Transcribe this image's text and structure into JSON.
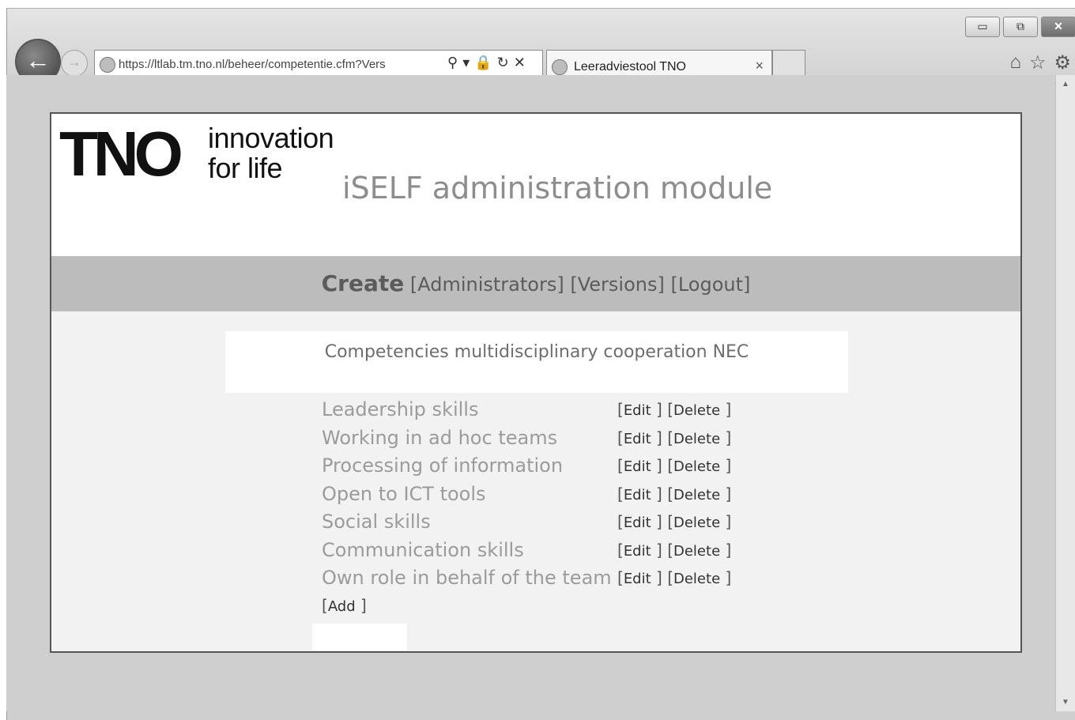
{
  "browser": {
    "url": "https://ltlab.tm.tno.nl/beheer/competentie.cfm?Vers",
    "tab_title": "Leeradviestool TNO",
    "window_controls": [
      "minimize-icon",
      "restore-icon",
      "close-icon"
    ],
    "toolbar_icons": [
      "home-icon",
      "favorites-icon",
      "settings-icon"
    ],
    "address_icons": [
      "search-icon",
      "dropdown-icon",
      "lock-icon",
      "refresh-icon",
      "stop-icon"
    ]
  },
  "header": {
    "logo_text": "TNO",
    "logo_tagline_1": "innovation",
    "logo_tagline_2": "for life",
    "app_title": "iSELF administration module"
  },
  "nav": {
    "create": "Create",
    "administrators": "[Administrators]",
    "versions": "[Versions]",
    "logout": "[Logout]"
  },
  "banner": {
    "title": "Competencies multidisciplinary cooperation NEC"
  },
  "competencies": [
    {
      "name": "Leadership skills",
      "edit": "Edit",
      "delete": "Delete"
    },
    {
      "name": "Working in ad hoc teams",
      "edit": "Edit",
      "delete": "Delete"
    },
    {
      "name": "Processing of information",
      "edit": "Edit",
      "delete": "Delete"
    },
    {
      "name": "Open to ICT tools",
      "edit": "Edit",
      "delete": "Delete"
    },
    {
      "name": "Social skills",
      "edit": "Edit",
      "delete": "Delete"
    },
    {
      "name": "Communication skills",
      "edit": "Edit",
      "delete": "Delete"
    },
    {
      "name": "Own role in behalf of the team",
      "edit": "Edit",
      "delete": "Delete"
    }
  ],
  "add_label": "Add"
}
